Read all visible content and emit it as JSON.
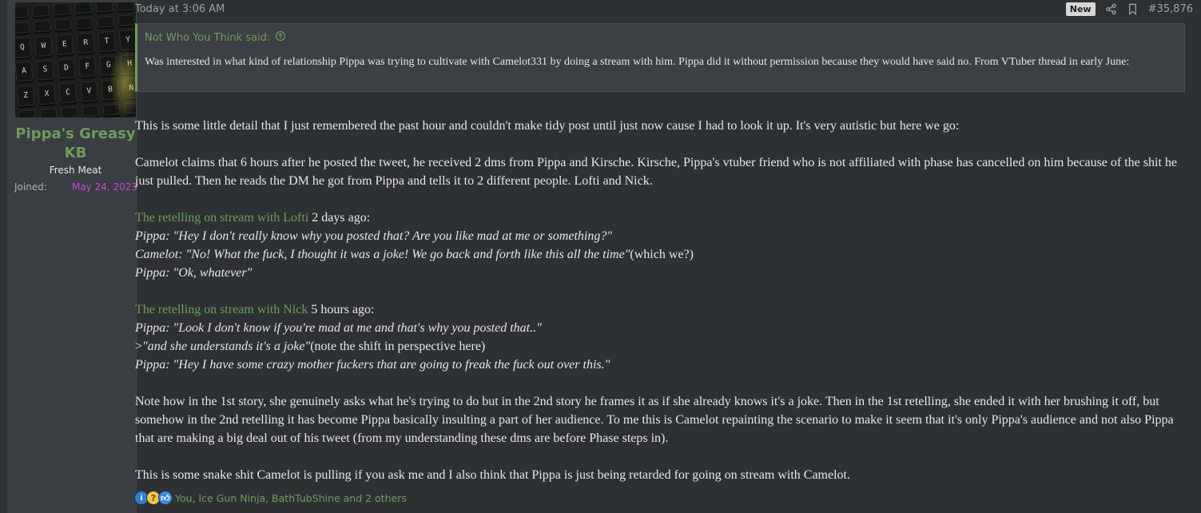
{
  "user": {
    "name": "Pippa's Greasy KB",
    "title": "Fresh Meat",
    "joined_label": "Joined:",
    "joined_date": "May 24, 2023",
    "avatar_keys": [
      "",
      "",
      "",
      "",
      "",
      "",
      "",
      "",
      "",
      "",
      "",
      "",
      "Q",
      "W",
      "E",
      "R",
      "T",
      "Y",
      "A",
      "S",
      "D",
      "F",
      "G",
      "H",
      "Z",
      "X",
      "C",
      "V",
      "B",
      "N",
      "",
      "",
      "",
      "",
      "",
      ""
    ]
  },
  "post": {
    "timestamp": "Today at 3:06 AM",
    "badge": "New",
    "number": "#35,876",
    "icons": [
      "share-icon",
      "bookmark-icon"
    ]
  },
  "quote": {
    "author": "Not Who You Think said:",
    "text": "Was interested in what kind of relationship Pippa was trying to cultivate with Camelot331 by doing a stream with him. Pippa did it without permission because they would have said no. From VTuber thread in early June:"
  },
  "content": {
    "p1": "This is some little detail that I just remembered the past hour and couldn't make tidy post until just now cause I had to look it up. It's very autistic but here we go:",
    "p2": "Camelot claims that 6 hours after he posted the tweet, he received 2 dms from Pippa and Kirsche. Kirsche, Pippa's vtuber friend who is not affiliated with phase has cancelled on him because of the shit he just pulled. Then he reads the DM he got from Pippa and tells it to 2 different people. Lofti and Nick.",
    "lofti_link": "The retelling on stream with Lofti",
    "lofti_when": " 2 days ago:",
    "lofti_line1": "Pippa: \"Hey I don't really know why you posted that? Are you like mad at me or something?\"",
    "lofti_line2": "Camelot: \"No! What the fuck, I thought it was a joke! We go back and forth like this all the time\"",
    "lofti_line2_note": "(which we?)",
    "lofti_line3": "Pippa: \"Ok, whatever\"",
    "nick_link": "The retelling on stream with Nick",
    "nick_when": " 5 hours ago:",
    "nick_line1": "Pippa: \"Look I don't know if you're mad at me and that's why you posted that..\"",
    "nick_line2_prefix": ">",
    "nick_line2": "\"and she understands it's a joke\"",
    "nick_line2_note": "(note the shift in perspective here)",
    "nick_line3": "Pippa: \"Hey I have some crazy mother fuckers that are going to freak the fuck out over this.\"",
    "p3": "Note how in the 1st story, she genuinely asks what he's trying to do but in the 2nd story he frames it as if she already knows it's a joke. Then in the 1st retelling, she ended it with her brushing it off, but somehow in the 2nd retelling it has become Pippa basically insulting a part of her audience. To me this is Camelot repainting the scenario to make it seem that it's only Pippa's audience and not also Pippa that are making a big deal out of his tweet (from my understanding these dms are before Phase steps in).",
    "p4": "This is some snake shit Camelot is pulling if you ask me and I also think that Pippa is just being retarded for going on stream with Camelot."
  },
  "reactions": {
    "icons": [
      "info-reaction-icon",
      "thinking-reaction-icon",
      "like-reaction-icon"
    ],
    "text": "You, Ice Gun Ninja, BathTubShine and 2 others"
  }
}
